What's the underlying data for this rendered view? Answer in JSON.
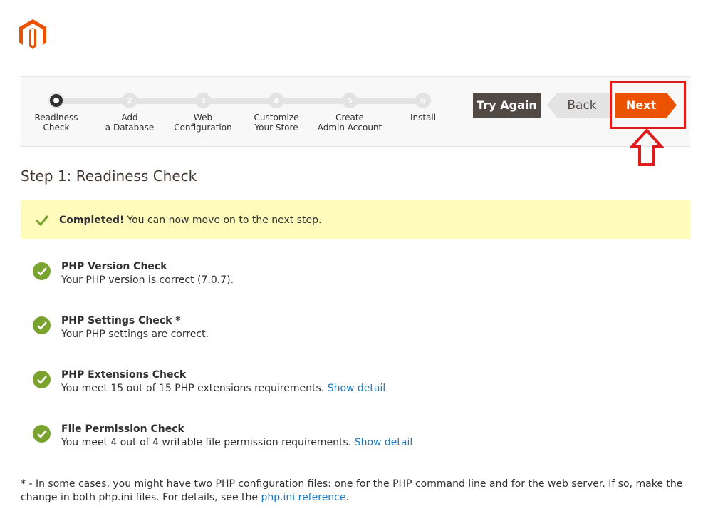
{
  "brand": {
    "logo_icon": "magento-logo-icon",
    "color": "#eb5202"
  },
  "wizard": {
    "steps": [
      {
        "number": "1",
        "label": "Readiness\nCheck",
        "active": true
      },
      {
        "number": "2",
        "label": "Add\na Database",
        "active": false
      },
      {
        "number": "3",
        "label": "Web\nConfiguration",
        "active": false
      },
      {
        "number": "4",
        "label": "Customize\nYour Store",
        "active": false
      },
      {
        "number": "5",
        "label": "Create\nAdmin Account",
        "active": false
      },
      {
        "number": "6",
        "label": "Install",
        "active": false
      }
    ],
    "buttons": {
      "try_again": "Try Again",
      "back": "Back",
      "next": "Next"
    }
  },
  "page": {
    "title": "Step 1: Readiness Check",
    "notice": {
      "strong": "Completed!",
      "text": "You can now move on to the next step."
    },
    "checks": [
      {
        "title": "PHP Version Check",
        "desc": "Your PHP version is correct (7.0.7).",
        "link": ""
      },
      {
        "title": "PHP Settings Check *",
        "desc": "Your PHP settings are correct.",
        "link": ""
      },
      {
        "title": "PHP Extensions Check",
        "desc": "You meet 15 out of 15 PHP extensions requirements.",
        "link": "Show detail"
      },
      {
        "title": "File Permission Check",
        "desc": "You meet 4 out of 4 writable file permission requirements.",
        "link": "Show detail"
      }
    ],
    "footnote": {
      "text": "* - In some cases, you might have two PHP configuration files: one for the PHP command line and for the web server. If so, make the change in both php.ini files. For details, see the",
      "link": "php.ini reference",
      "end": "."
    }
  },
  "colors": {
    "success": "#79a22e",
    "notice_bg": "#fffbbb",
    "link": "#1979c3",
    "annotation": "#e01b1b",
    "dark_button": "#514943"
  }
}
